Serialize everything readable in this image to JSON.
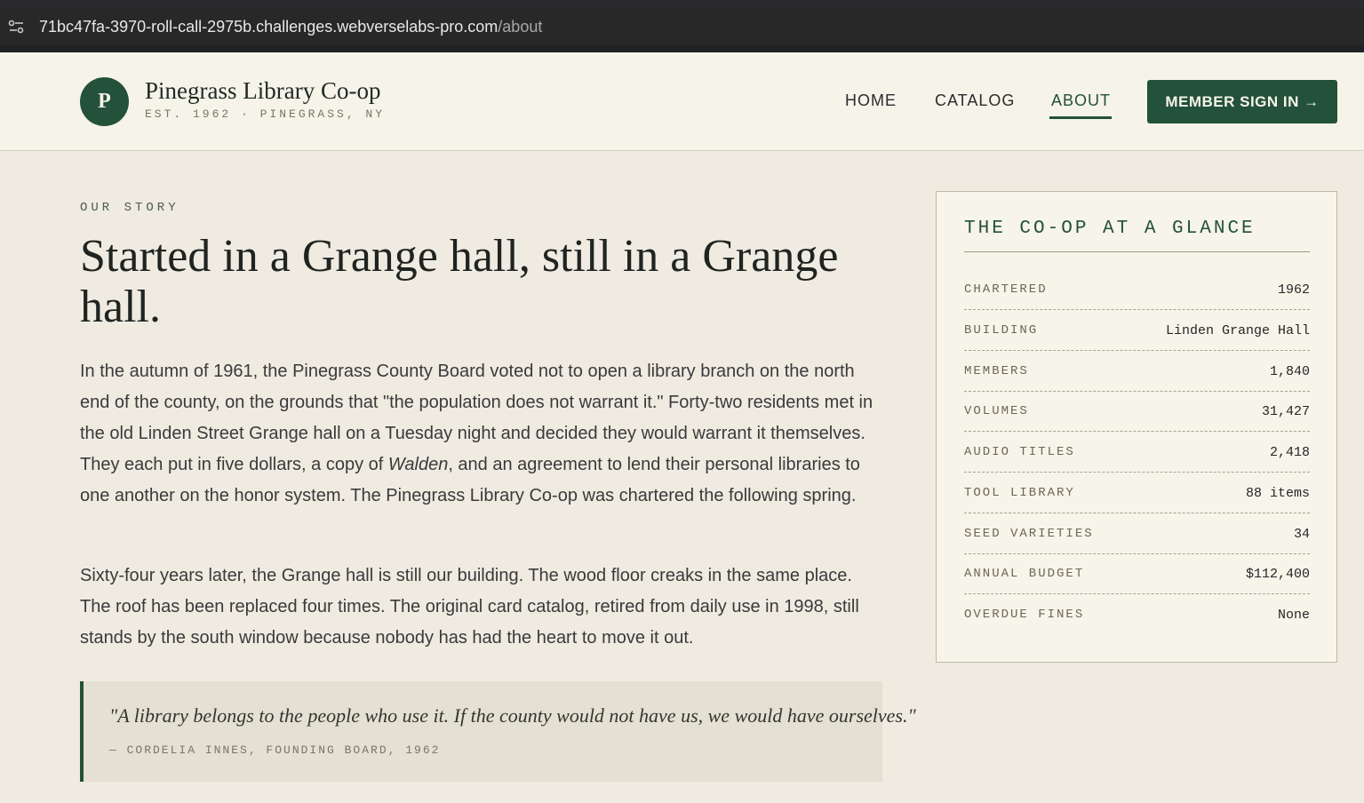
{
  "browser": {
    "url_host": "71bc47fa-3970-roll-call-2975b.challenges.webverselabs-pro.com",
    "url_path": "/about",
    "site_info_icon": "tune-icon"
  },
  "header": {
    "logo_letter": "P",
    "brand_name": "Pinegrass Library Co-op",
    "brand_sub": "EST. 1962 · PINEGRASS, NY",
    "nav": {
      "home": "HOME",
      "catalog": "CATALOG",
      "about": "ABOUT"
    },
    "active_nav": "about",
    "signin_label": "MEMBER SIGN IN →"
  },
  "main": {
    "eyebrow": "OUR STORY",
    "title": "Started in a Grange hall, still in a Grange hall.",
    "para1_before": "In the autumn of 1961, the Pinegrass County Board voted not to open a library branch on the north end of the county, on the grounds that \"the population does not warrant it.\" Forty-two residents met in the old Linden Street Grange hall on a Tuesday night and decided they would warrant it themselves. They each put in five dollars, a copy of ",
    "para1_em": "Walden",
    "para1_after": ", and an agreement to lend their personal libraries to one another on the honor system. The Pinegrass Library Co-op was chartered the following spring.",
    "para2": "Sixty-four years later, the Grange hall is still our building. The wood floor creaks in the same place. The roof has been replaced four times. The original card catalog, retired from daily use in 1998, still stands by the south window because nobody has had the heart to move it out.",
    "quote": {
      "text": "\"A library belongs to the people who use it. If the county would not have us, we would have ourselves.\"",
      "cite": "— CORDELIA INNES, FOUNDING BOARD, 1962"
    }
  },
  "glance": {
    "title": "THE CO-OP AT A GLANCE",
    "rows": [
      {
        "label": "CHARTERED",
        "value": "1962"
      },
      {
        "label": "BUILDING",
        "value": "Linden Grange Hall"
      },
      {
        "label": "MEMBERS",
        "value": "1,840"
      },
      {
        "label": "VOLUMES",
        "value": "31,427"
      },
      {
        "label": "AUDIO TITLES",
        "value": "2,418"
      },
      {
        "label": "TOOL LIBRARY",
        "value": "88 items"
      },
      {
        "label": "SEED VARIETIES",
        "value": "34"
      },
      {
        "label": "ANNUAL BUDGET",
        "value": "$112,400"
      },
      {
        "label": "OVERDUE FINES",
        "value": "None"
      }
    ]
  },
  "colors": {
    "brand_green": "#23513a",
    "page_bg": "#efebe1",
    "header_bg": "#f6f3e9"
  }
}
